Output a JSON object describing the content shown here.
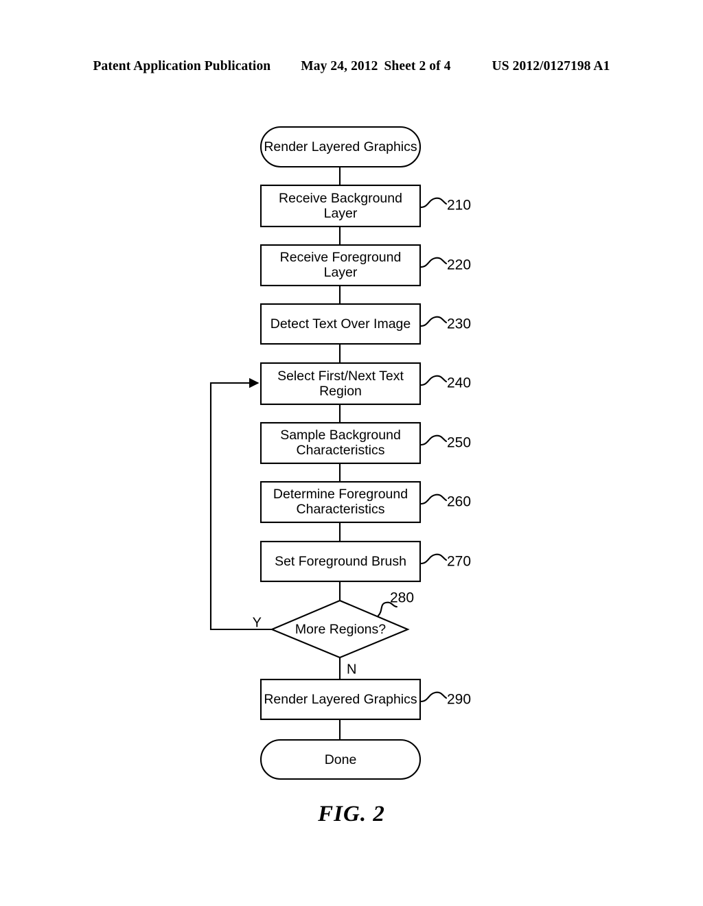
{
  "header": {
    "publication": "Patent Application Publication",
    "date": "May 24, 2012",
    "sheet": "Sheet 2 of 4",
    "pub_number": "US 2012/0127198 A1"
  },
  "figure": {
    "caption": "FIG. 2"
  },
  "chart_data": {
    "type": "diagram",
    "title": "FIG. 2",
    "nodes": [
      {
        "id": "start",
        "shape": "stadium",
        "label": "Render Layered Graphics",
        "ref": ""
      },
      {
        "id": "n210",
        "shape": "rect",
        "label": "Receive Background Layer",
        "ref": "210"
      },
      {
        "id": "n220",
        "shape": "rect",
        "label": "Receive Foreground Layer",
        "ref": "220"
      },
      {
        "id": "n230",
        "shape": "rect",
        "label": "Detect Text Over Image",
        "ref": "230"
      },
      {
        "id": "n240",
        "shape": "rect",
        "label": "Select First/Next Text Region",
        "ref": "240"
      },
      {
        "id": "n250",
        "shape": "rect",
        "label": "Sample Background Characteristics",
        "ref": "250"
      },
      {
        "id": "n260",
        "shape": "rect",
        "label": "Determine Foreground Characteristics",
        "ref": "260"
      },
      {
        "id": "n270",
        "shape": "rect",
        "label": "Set Foreground Brush",
        "ref": "270"
      },
      {
        "id": "n280",
        "shape": "diamond",
        "label": "More Regions?",
        "ref": "280"
      },
      {
        "id": "n290",
        "shape": "rect",
        "label": "Render Layered Graphics",
        "ref": "290"
      },
      {
        "id": "end",
        "shape": "stadium",
        "label": "Done",
        "ref": ""
      }
    ],
    "edges": [
      {
        "from": "start",
        "to": "n210",
        "label": ""
      },
      {
        "from": "n210",
        "to": "n220",
        "label": ""
      },
      {
        "from": "n220",
        "to": "n230",
        "label": ""
      },
      {
        "from": "n230",
        "to": "n240",
        "label": ""
      },
      {
        "from": "n240",
        "to": "n250",
        "label": ""
      },
      {
        "from": "n250",
        "to": "n260",
        "label": ""
      },
      {
        "from": "n260",
        "to": "n270",
        "label": ""
      },
      {
        "from": "n270",
        "to": "n280",
        "label": ""
      },
      {
        "from": "n280",
        "to": "n240",
        "label": "Y"
      },
      {
        "from": "n280",
        "to": "n290",
        "label": "N"
      },
      {
        "from": "n290",
        "to": "end",
        "label": ""
      }
    ]
  },
  "nodes": {
    "start": {
      "line1": "Render Layered Graphics"
    },
    "n210": {
      "line1": "Receive Background",
      "line2": "Layer",
      "ref": "210"
    },
    "n220": {
      "line1": "Receive Foreground",
      "line2": "Layer",
      "ref": "220"
    },
    "n230": {
      "line1": "Detect Text Over Image",
      "ref": "230"
    },
    "n240": {
      "line1": "Select First/Next Text",
      "line2": "Region",
      "ref": "240"
    },
    "n250": {
      "line1": "Sample Background",
      "line2": "Characteristics",
      "ref": "250"
    },
    "n260": {
      "line1": "Determine Foreground",
      "line2": "Characteristics",
      "ref": "260"
    },
    "n270": {
      "line1": "Set Foreground Brush",
      "ref": "270"
    },
    "n280": {
      "line1": "More Regions?",
      "ref": "280"
    },
    "n290": {
      "line1": "Render Layered Graphics",
      "ref": "290"
    },
    "end": {
      "line1": "Done"
    }
  },
  "branches": {
    "yes": "Y",
    "no": "N"
  },
  "colors": {
    "ink": "#000000",
    "paper": "#ffffff"
  }
}
